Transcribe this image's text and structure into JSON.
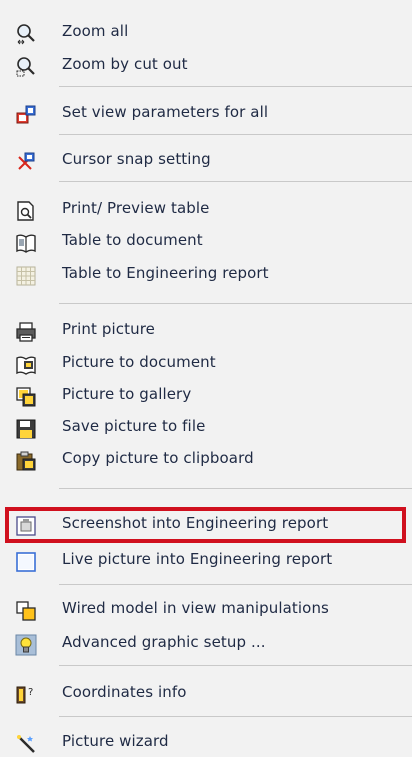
{
  "menu": {
    "items": [
      {
        "label": "Zoom all",
        "icon": "zoom-all-icon"
      },
      {
        "label": "Zoom by cut out",
        "icon": "zoom-cutout-icon"
      },
      {
        "label": "Set view parameters for all",
        "icon": "view-params-icon"
      },
      {
        "label": "Cursor snap setting",
        "icon": "cursor-snap-icon"
      },
      {
        "label": "Print/ Preview table",
        "icon": "print-preview-icon"
      },
      {
        "label": "Table to document",
        "icon": "table-to-document-icon"
      },
      {
        "label": "Table to Engineering report",
        "icon": "table-grid-icon"
      },
      {
        "label": "Print picture",
        "icon": "print-picture-icon"
      },
      {
        "label": "Picture to document",
        "icon": "picture-to-document-icon"
      },
      {
        "label": "Picture to gallery",
        "icon": "picture-gallery-icon"
      },
      {
        "label": "Save picture to file",
        "icon": "save-disk-icon"
      },
      {
        "label": "Copy picture to clipboard",
        "icon": "clipboard-icon"
      },
      {
        "label": "Screenshot into Engineering report",
        "icon": "screenshot-icon"
      },
      {
        "label": "Live picture into Engineering report",
        "icon": "live-picture-icon"
      },
      {
        "label": "Wired model in view manipulations",
        "icon": "wired-model-icon"
      },
      {
        "label": "Advanced graphic setup ...",
        "icon": "lightbulb-icon"
      },
      {
        "label": "Coordinates info",
        "icon": "coordinates-info-icon"
      },
      {
        "label": "Picture wizard",
        "icon": "wand-icon"
      }
    ]
  },
  "colors": {
    "highlight": "#d0101e",
    "text": "#1f2a44",
    "separator": "#c9c9c9"
  }
}
